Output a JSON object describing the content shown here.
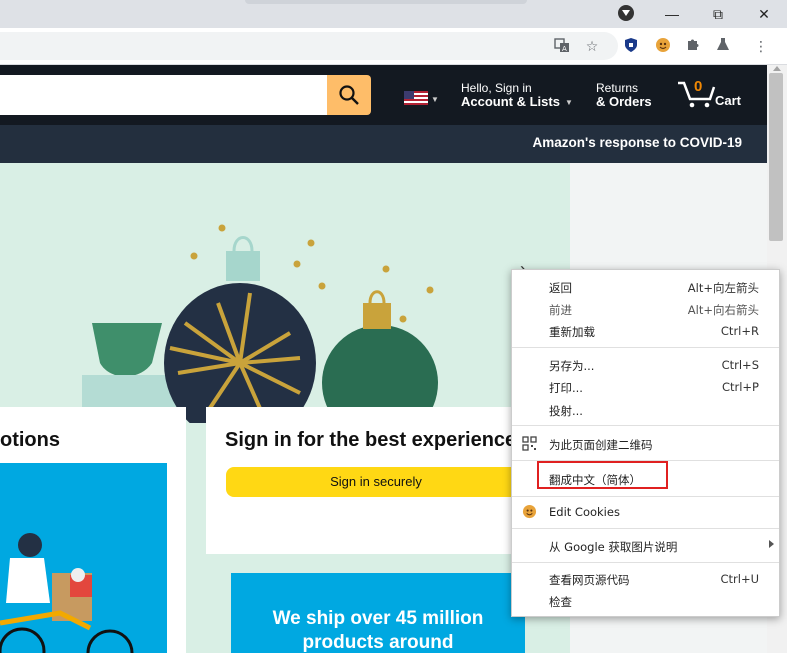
{
  "window": {
    "minimize": "—",
    "restore": "⧉",
    "close": "✕"
  },
  "toolbar": {
    "translate_icon": "translate-icon",
    "star_icon": "bookmark-star-icon",
    "extensions_icon": "puzzle-icon",
    "labs_icon": "flask-icon",
    "menu_icon": "kebab-menu-icon"
  },
  "amazon": {
    "hello": "Hello, Sign in",
    "account": "Account & Lists",
    "returns": "Returns",
    "orders": "& Orders",
    "cart_count": "0",
    "cart": "Cart",
    "covid": "Amazon's response to COVID-19",
    "card_left_title": "otions",
    "card_signin_title": "Sign in for the best experience",
    "signin_button": "Sign in securely",
    "ship_line1": "We ship over 45 million",
    "ship_line2": "products around",
    "hero_arrow": "›"
  },
  "context_menu": {
    "back": {
      "label": "返回",
      "shortcut": "Alt+向左箭头"
    },
    "forward": {
      "label": "前进",
      "shortcut": "Alt+向右箭头"
    },
    "reload": {
      "label": "重新加载",
      "shortcut": "Ctrl+R"
    },
    "save_as": {
      "label": "另存为...",
      "shortcut": "Ctrl+S"
    },
    "print": {
      "label": "打印...",
      "shortcut": "Ctrl+P"
    },
    "cast": {
      "label": "投射..."
    },
    "qr": {
      "label": "为此页面创建二维码"
    },
    "translate": {
      "label": "翻成中文（简体）"
    },
    "edit_cookies": {
      "label": "Edit Cookies"
    },
    "google_lens": {
      "label": "从 Google 获取图片说明"
    },
    "view_source": {
      "label": "查看网页源代码",
      "shortcut": "Ctrl+U"
    },
    "inspect": {
      "label": "检查"
    }
  },
  "colors": {
    "amazon_nav": "#131921",
    "amazon_subnav": "#232f3e",
    "search_button": "#febd69",
    "signin_button": "#ffd814",
    "highlight": "#e02020"
  }
}
